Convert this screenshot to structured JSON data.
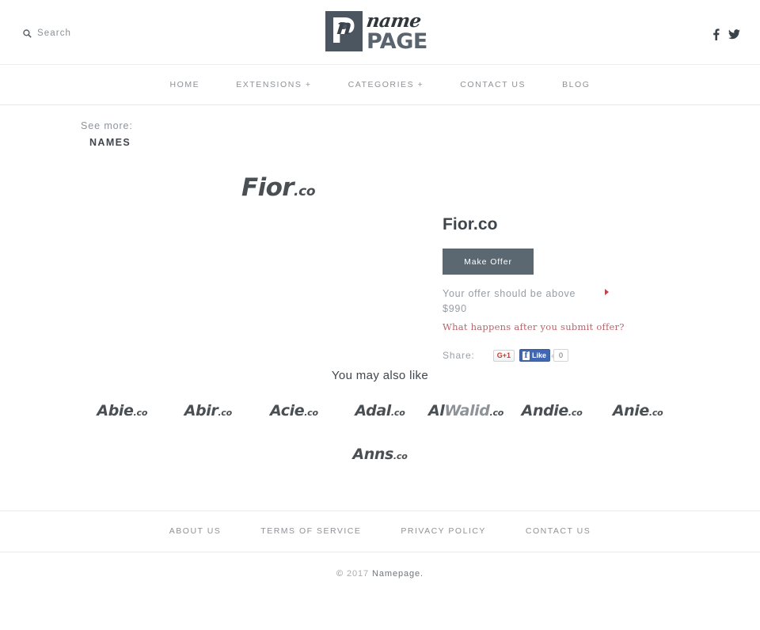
{
  "header": {
    "search": {
      "label": "Search",
      "icon": "search-icon"
    },
    "logo": {
      "mark_letter": "P",
      "script_letter": "n",
      "name": "name",
      "page": "PAGE"
    },
    "social": [
      {
        "name": "facebook-icon",
        "label": "f"
      },
      {
        "name": "twitter-icon",
        "label": "t"
      }
    ]
  },
  "nav": {
    "items": [
      {
        "label": "HOME"
      },
      {
        "label": "EXTENSIONS +"
      },
      {
        "label": "CATEGORIES +"
      },
      {
        "label": "CONTACT US"
      },
      {
        "label": "BLOG"
      }
    ]
  },
  "see_more": {
    "label": "See more:",
    "value": "NAMES"
  },
  "hero": {
    "name": "Fior",
    "tld": ".co"
  },
  "offer": {
    "title": "Fior.co",
    "button_label": "Make Offer",
    "note_line1": "Your offer should be above",
    "note_line2": "$990",
    "link_label": "What happens after you submit offer?",
    "marker_color": "#c0444c",
    "button_color": "#5b6771",
    "link_color": "#b9636b"
  },
  "share": {
    "label": "Share:",
    "google_plus_label": "G+1",
    "facebook_label": "Like",
    "facebook_f": "f",
    "facebook_count": "0"
  },
  "also_like": {
    "title": "You may also like",
    "items": [
      {
        "name": "Abie",
        "tld": ".co"
      },
      {
        "name": "Abir",
        "tld": ".co"
      },
      {
        "name": "Acie",
        "tld": ".co"
      },
      {
        "name": "Adal",
        "tld": ".co"
      },
      {
        "name": "Al",
        "name_dim": "Walid",
        "tld": ".co"
      },
      {
        "name": "Andie",
        "tld": ".co"
      },
      {
        "name": "Anie",
        "tld": ".co"
      },
      {
        "name": "Anns",
        "tld": ".co"
      }
    ]
  },
  "footer": {
    "links": [
      {
        "label": "ABOUT US"
      },
      {
        "label": "TERMS OF SERVICE"
      },
      {
        "label": "PRIVACY POLICY"
      },
      {
        "label": "CONTACT US"
      }
    ],
    "copyright_symbol": "©",
    "copyright_year": "2017",
    "copyright_brand": "Namepage."
  }
}
